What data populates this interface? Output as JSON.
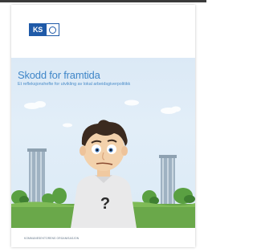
{
  "publisher_logo": {
    "text": "KS"
  },
  "cover": {
    "title": "Skodd for framtida",
    "subtitle": "Et refleksjonshefte for utvikling av lokal arbeidsgiverpolitikk",
    "illustration_mark": "?",
    "footer": "KOMMUNESEKTORENS ORGANISASJON"
  },
  "colors": {
    "title_blue": "#3f86c8",
    "logo_blue": "#1f5aa8",
    "sky": "#dbe9f6",
    "grass": "#5aa042"
  },
  "icons": [
    "ks-logo-icon",
    "ring-logo-icon"
  ]
}
